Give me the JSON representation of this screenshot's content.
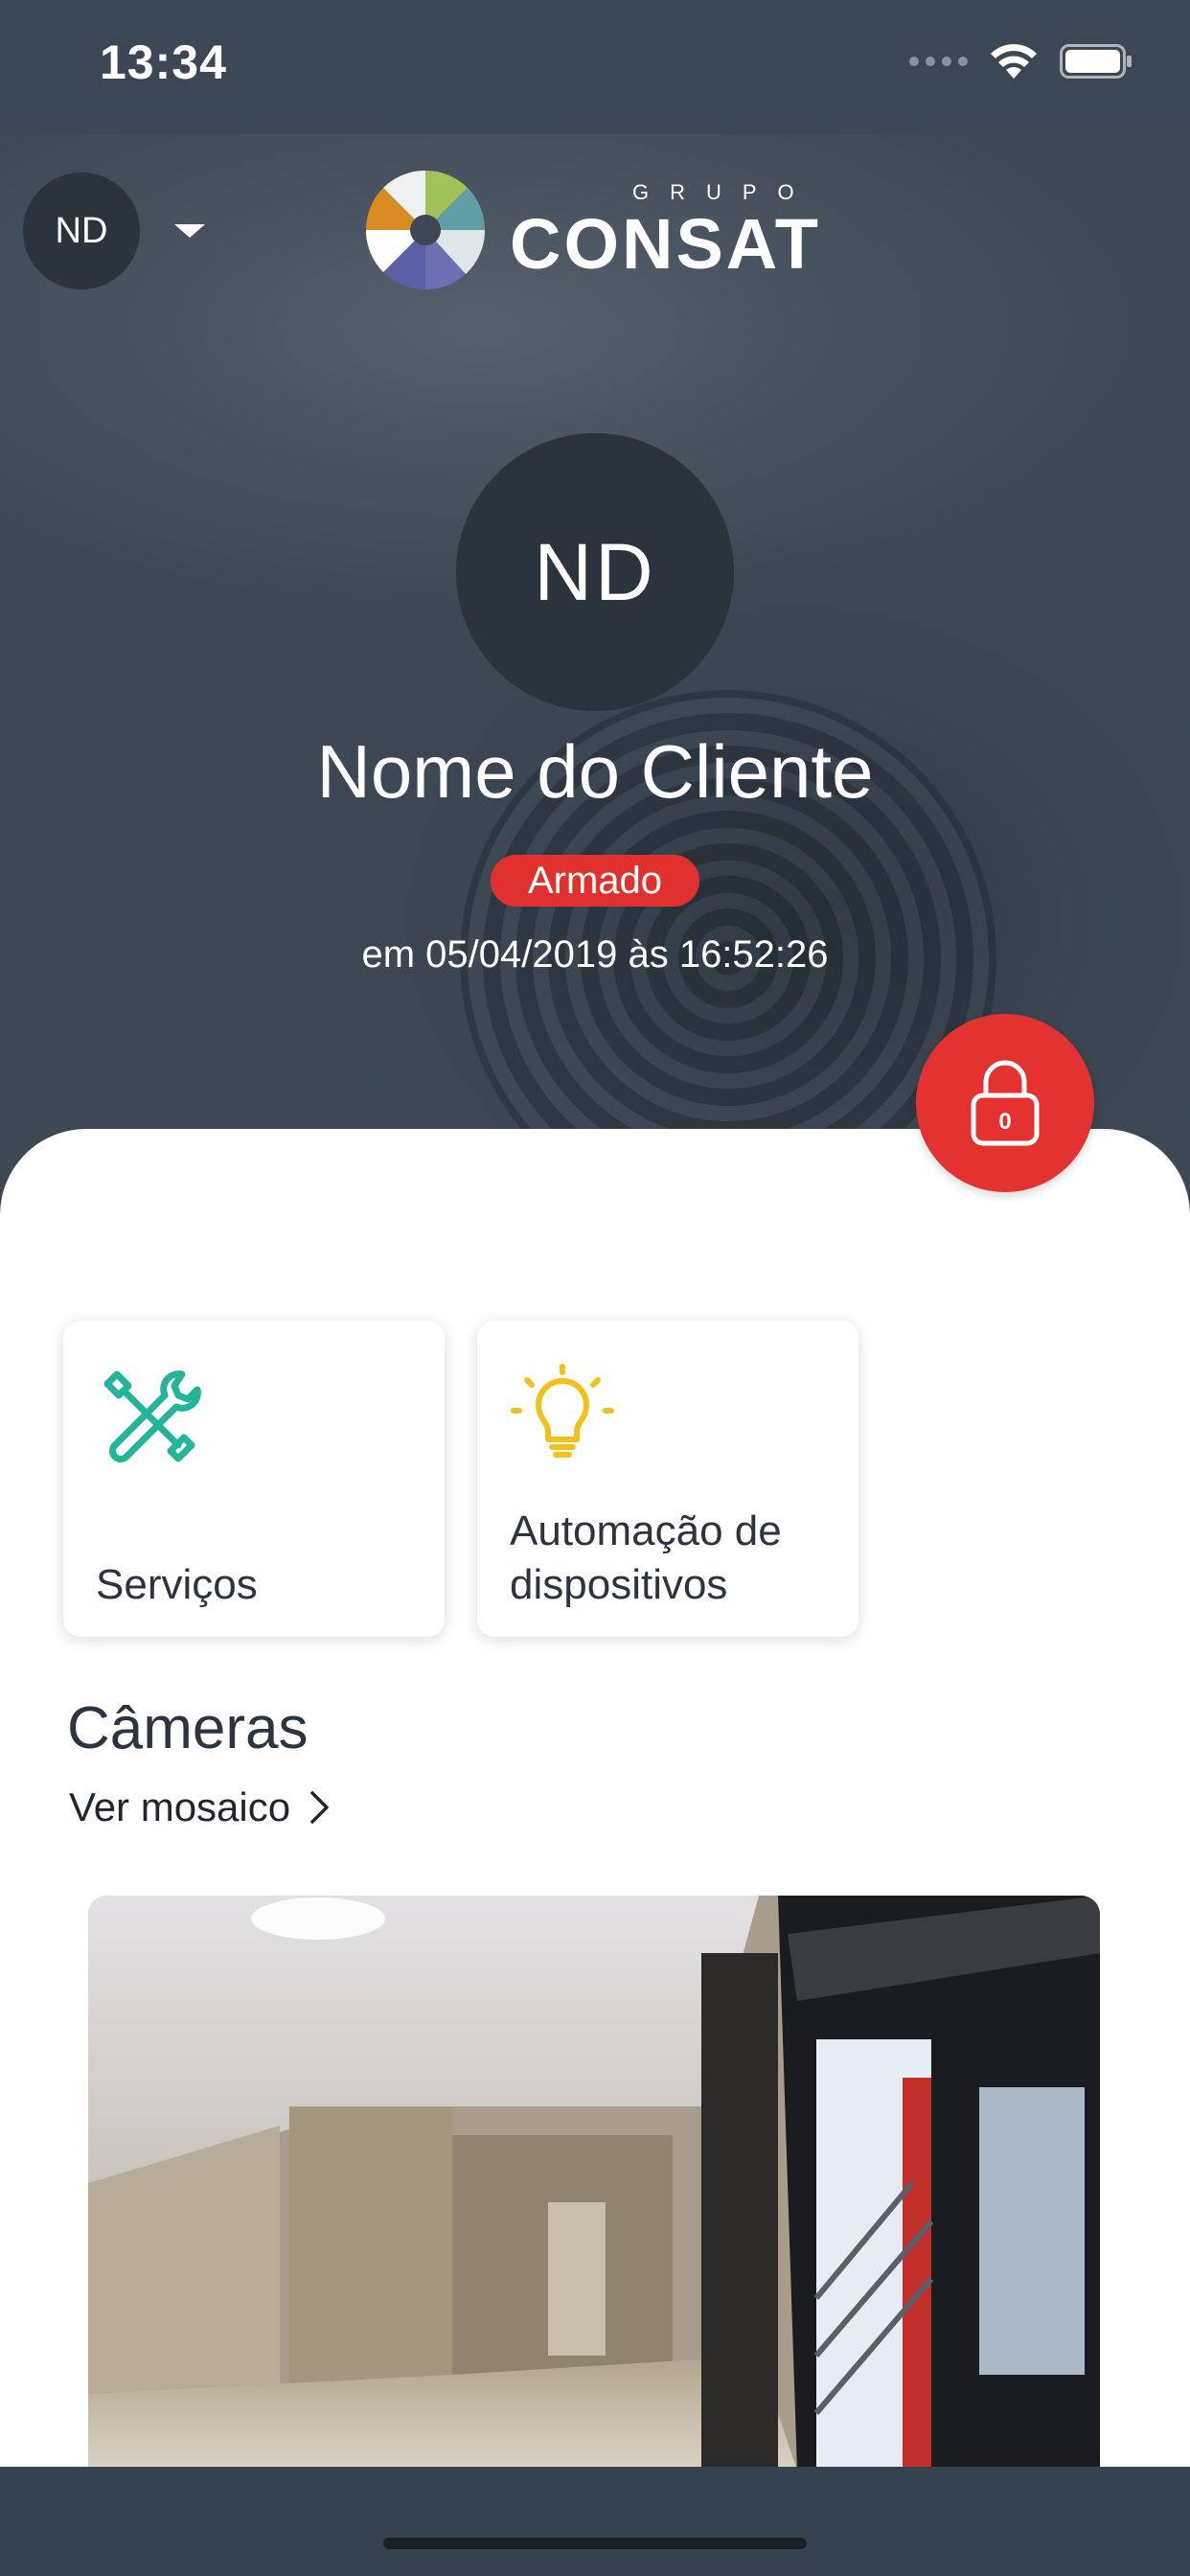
{
  "status_bar": {
    "time": "13:34"
  },
  "header": {
    "account_initials": "ND",
    "logo": {
      "small_text": "GRUPO",
      "brand": "CONSAT"
    }
  },
  "profile": {
    "initials": "ND",
    "name": "Nome do Cliente",
    "status": "Armado",
    "status_time": "em 05/04/2019 às 16:52:26",
    "lock_count": "0"
  },
  "shortcuts": [
    {
      "label": "Serviços",
      "icon": "tools-icon"
    },
    {
      "label": "Automação de dispositivos",
      "icon": "lightbulb-icon"
    }
  ],
  "cameras": {
    "title": "Câmeras",
    "mosaic_link": "Ver mosaico"
  },
  "colors": {
    "header_bg": "#3b4754",
    "alert_red": "#e3322f",
    "tools_icon": "#22b59a",
    "bulb_icon": "#f2c21b",
    "text_dark": "#2c3440"
  }
}
